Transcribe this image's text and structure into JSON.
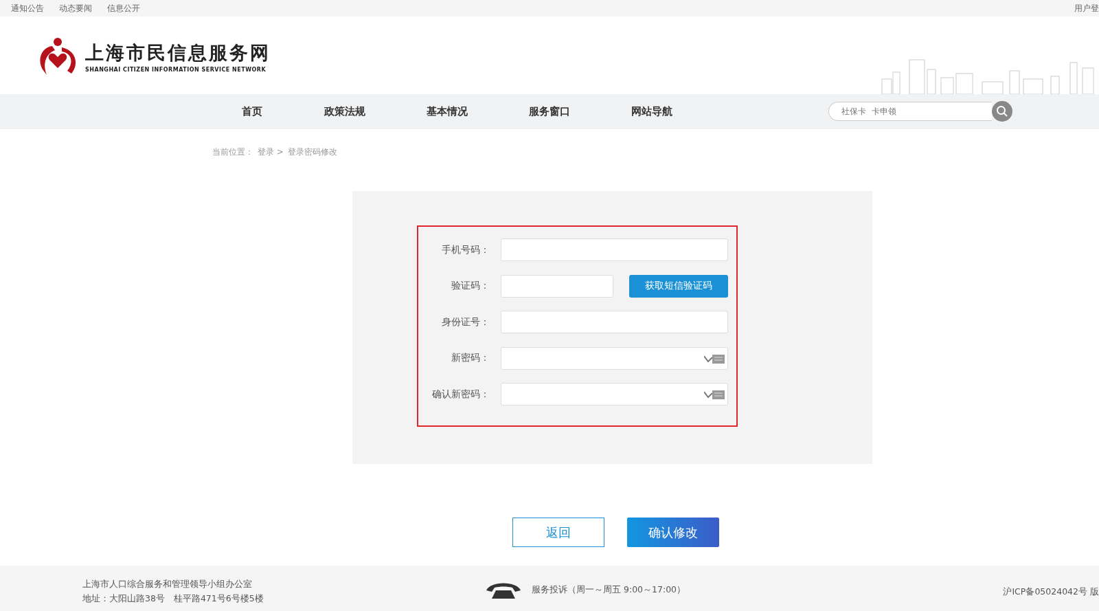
{
  "top_bar": {
    "links": [
      "通知公告",
      "动态要闻",
      "信息公开"
    ],
    "login": "用户登"
  },
  "header": {
    "logo_title": "上海市民信息服务网",
    "logo_subtitle": "SHANGHAI CITIZEN INFORMATION SERVICE NETWORK"
  },
  "nav": {
    "items": [
      "首页",
      "政策法规",
      "基本情况",
      "服务窗口",
      "网站导航"
    ],
    "search": {
      "placeholder": "社保卡  卡申领"
    }
  },
  "breadcrumb": {
    "label": "当前位置：",
    "items": [
      "登录 >",
      "登录密码修改"
    ]
  },
  "form": {
    "fields": [
      {
        "kind": "text",
        "label": "手机号码："
      },
      {
        "kind": "code",
        "label": "验证码：",
        "button": "获取短信验证码"
      },
      {
        "kind": "text",
        "label": "身份证号："
      },
      {
        "kind": "password",
        "label": "新密码："
      },
      {
        "kind": "password",
        "label": "确认新密码："
      }
    ]
  },
  "actions": {
    "back": "返回",
    "confirm": "确认修改"
  },
  "footer": {
    "org": "上海市人口综合服务和管理领导小组办公室",
    "address": "地址：大阳山路38号　桂平路471号6号楼5楼",
    "hotline": "服务投诉（周一～周五 9:00～17:00）",
    "icp": "沪ICP备05024042号 版"
  }
}
